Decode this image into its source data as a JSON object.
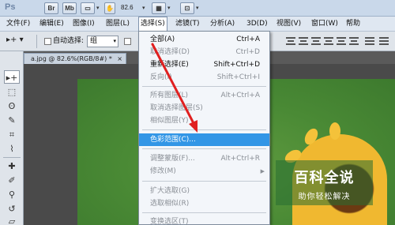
{
  "titlebar": {
    "logo": "Ps",
    "br_label": "Br",
    "mb_label": "Mb",
    "zoom": "82.6"
  },
  "menu": {
    "items": [
      "文件(F)",
      "编辑(E)",
      "图像(I)",
      "图层(L)",
      "选择(S)",
      "滤镜(T)",
      "分析(A)",
      "3D(D)",
      "视图(V)",
      "窗口(W)",
      "帮助"
    ],
    "active_index": 4
  },
  "options": {
    "auto_select_label": "自动选择:",
    "auto_select_value": "组"
  },
  "document": {
    "tab_label": "a.jpg @ 82.6%(RGB/8#) *",
    "close": "×"
  },
  "dropdown": {
    "items": [
      {
        "label": "全部(A)",
        "shortcut": "Ctrl+A",
        "disabled": false
      },
      {
        "label": "取消选择(D)",
        "shortcut": "Ctrl+D",
        "disabled": true
      },
      {
        "label": "重新选择(E)",
        "shortcut": "Shift+Ctrl+D",
        "disabled": false
      },
      {
        "label": "反向(I)",
        "shortcut": "Shift+Ctrl+I",
        "disabled": true
      },
      {
        "label": "所有图层(L)",
        "shortcut": "Alt+Ctrl+A",
        "disabled": true
      },
      {
        "label": "取消选择图层(S)",
        "shortcut": "",
        "disabled": true
      },
      {
        "label": "相似图层(Y)",
        "shortcut": "",
        "disabled": true
      },
      {
        "label": "色彩范围(C)...",
        "shortcut": "",
        "disabled": false,
        "highlighted": true
      },
      {
        "label": "调整蒙版(F)...",
        "shortcut": "Alt+Ctrl+R",
        "disabled": true
      },
      {
        "label": "修改(M)",
        "shortcut": "",
        "disabled": true,
        "submenu": true
      },
      {
        "label": "扩大选取(G)",
        "shortcut": "",
        "disabled": true
      },
      {
        "label": "选取相似(R)",
        "shortcut": "",
        "disabled": true
      },
      {
        "label": "变换选区(T)",
        "shortcut": "",
        "disabled": true
      }
    ]
  },
  "watermark": {
    "title": "百科全说",
    "subtitle": "助你轻松解决"
  },
  "colors": {
    "highlight": "#3296e6",
    "arrow": "#e02020",
    "canvas_green": "#4a8a35"
  }
}
